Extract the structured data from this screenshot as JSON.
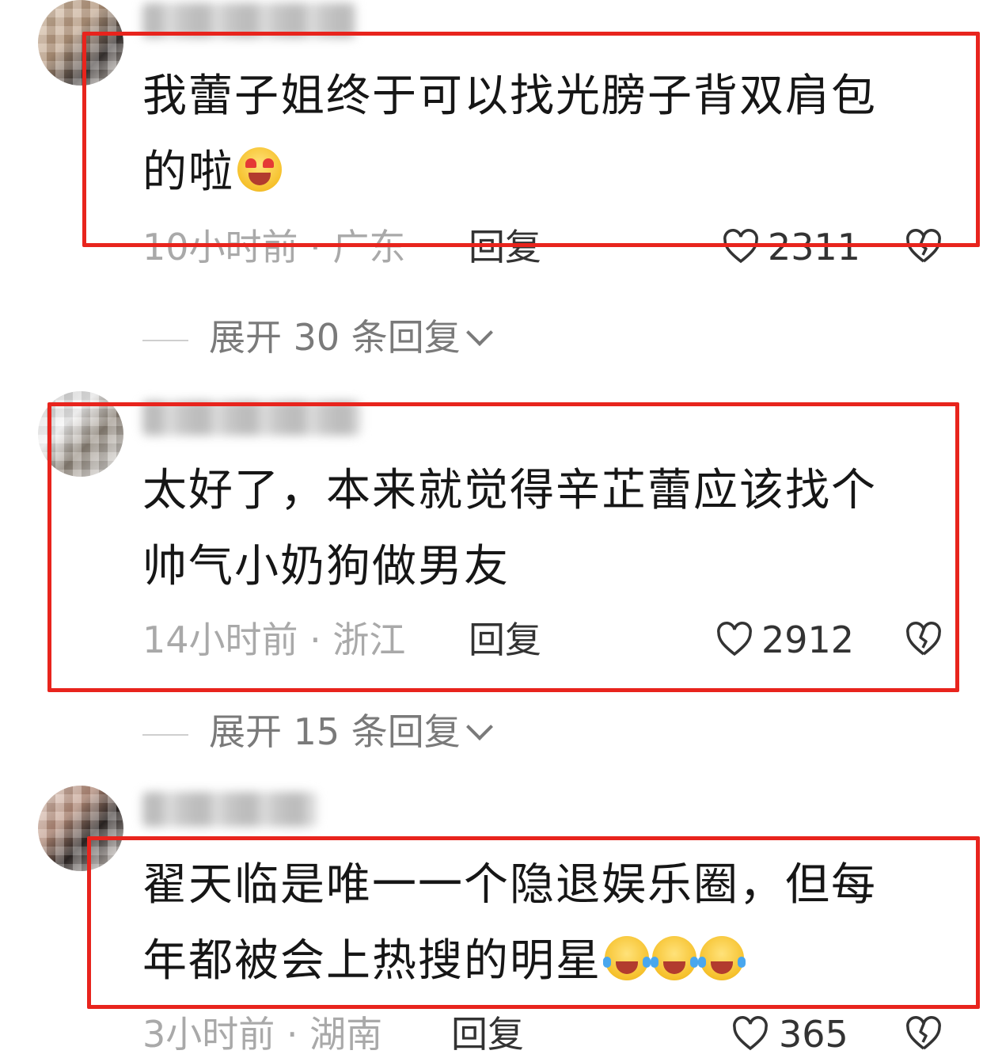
{
  "comments": [
    {
      "text": "我蕾子姐终于可以找光膀子背双肩包的啦",
      "emojis": [
        "heart-eyes-tongue-emoji"
      ],
      "meta": "10小时前 · 广东",
      "reply_label": "回复",
      "likes": "2311",
      "expand_label": "展开 30 条回复"
    },
    {
      "text": "太好了，本来就觉得辛芷蕾应该找个帅气小奶狗做男友",
      "emojis": [],
      "meta": "14小时前 · 浙江",
      "reply_label": "回复",
      "likes": "2912",
      "expand_label": "展开 15 条回复"
    },
    {
      "text": "翟天临是唯一一个隐退娱乐圈，但每年都被会上热搜的明星",
      "emojis": [
        "tears-of-joy-emoji",
        "tears-of-joy-emoji",
        "tears-of-joy-emoji"
      ],
      "meta": "3小时前 · 湖南",
      "reply_label": "回复",
      "likes": "365"
    }
  ],
  "colors": {
    "highlight": "#e8241d",
    "meta_gray": "#a9a9a9",
    "text": "#161616"
  }
}
